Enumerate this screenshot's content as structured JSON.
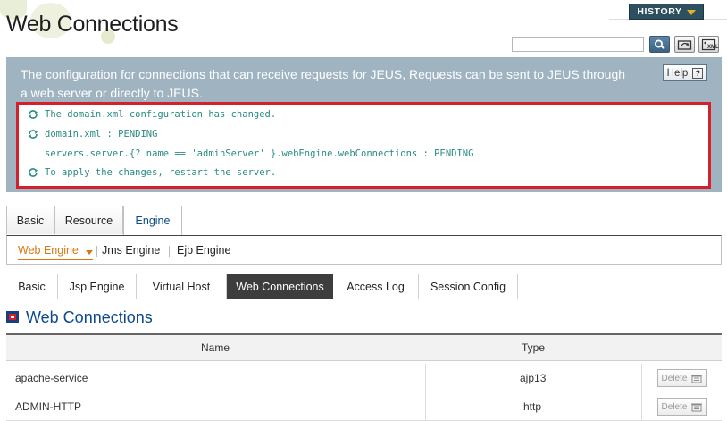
{
  "page": {
    "title": "Web Connections"
  },
  "toolbar": {
    "history_label": "HISTORY",
    "search_placeholder": "",
    "xml_label": "XML"
  },
  "info": {
    "description": "The configuration for connections that can receive requests for JEUS, Requests can be sent to JEUS through a web server or directly to JEUS.",
    "help_label": "Help",
    "messages": [
      {
        "text": "The domain.xml configuration has changed.",
        "icon": "refresh-icon"
      },
      {
        "text": "domain.xml : PENDING",
        "icon": "refresh-icon"
      },
      {
        "text": "servers.server.{? name == 'adminServer' }.webEngine.webConnections : PENDING",
        "icon": ""
      },
      {
        "text": "To apply the changes, restart the server.",
        "icon": "refresh-icon"
      }
    ]
  },
  "tabs": [
    "Basic",
    "Resource",
    "Engine"
  ],
  "active_tab": "Engine",
  "subnav": [
    "Web Engine",
    "Jms Engine",
    "Ejb Engine"
  ],
  "active_subnav": "Web Engine",
  "tabs2": [
    "Basic",
    "Jsp Engine",
    "Virtual Host",
    "Web Connections",
    "Access Log",
    "Session Config"
  ],
  "active_tab2": "Web Connections",
  "section": {
    "title": "Web Connections"
  },
  "table": {
    "columns": [
      "Name",
      "Type"
    ],
    "rows": [
      {
        "name": "apache-service",
        "type": "ajp13",
        "action": "Delete"
      },
      {
        "name": "ADMIN-HTTP",
        "type": "http",
        "action": "Delete"
      }
    ]
  },
  "colors": {
    "info_panel": "#9fb3c1",
    "alert_border": "#d3202b",
    "message_text": "#2a8b82",
    "active_subnav": "#d9770e",
    "section_title": "#0d4a8c"
  }
}
